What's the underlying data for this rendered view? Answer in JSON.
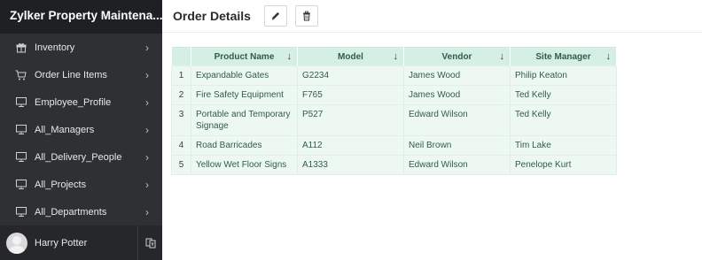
{
  "app": {
    "title": "Zylker Property Maintena..."
  },
  "sidebar": {
    "items": [
      {
        "label": "Inventory",
        "icon": "gift-icon"
      },
      {
        "label": "Order Line Items",
        "icon": "cart-icon"
      },
      {
        "label": "Employee_Profile",
        "icon": "monitor-icon"
      },
      {
        "label": "All_Managers",
        "icon": "monitor-icon"
      },
      {
        "label": "All_Delivery_People",
        "icon": "monitor-icon"
      },
      {
        "label": "All_Projects",
        "icon": "monitor-icon"
      },
      {
        "label": "All_Departments",
        "icon": "monitor-icon"
      }
    ],
    "chevron": "›"
  },
  "user": {
    "name": "Harry Potter"
  },
  "page": {
    "title": "Order Details"
  },
  "table": {
    "columns": [
      "Product Name",
      "Model",
      "Vendor",
      "Site Manager"
    ],
    "sort_glyph": "↓",
    "rows": [
      {
        "index": "1",
        "cells": [
          "Expandable Gates",
          "G2234",
          "James Wood",
          "Philip Keaton"
        ]
      },
      {
        "index": "2",
        "cells": [
          "Fire Safety Equipment",
          "F765",
          "James Wood",
          "Ted Kelly"
        ]
      },
      {
        "index": "3",
        "cells": [
          "Portable and Temporary Signage",
          "P527",
          "Edward Wilson",
          "Ted Kelly"
        ]
      },
      {
        "index": "4",
        "cells": [
          "Road Barricades",
          "A112",
          "Neil Brown",
          "Tim Lake"
        ]
      },
      {
        "index": "5",
        "cells": [
          "Yellow Wet Floor Signs",
          "A1333",
          "Edward Wilson",
          "Penelope Kurt"
        ]
      }
    ]
  },
  "colors": {
    "sidebar": "#2f3034",
    "header_cell": "#d5efe4",
    "row_cell": "#edf8f3",
    "text_green": "#2f5d4a"
  }
}
